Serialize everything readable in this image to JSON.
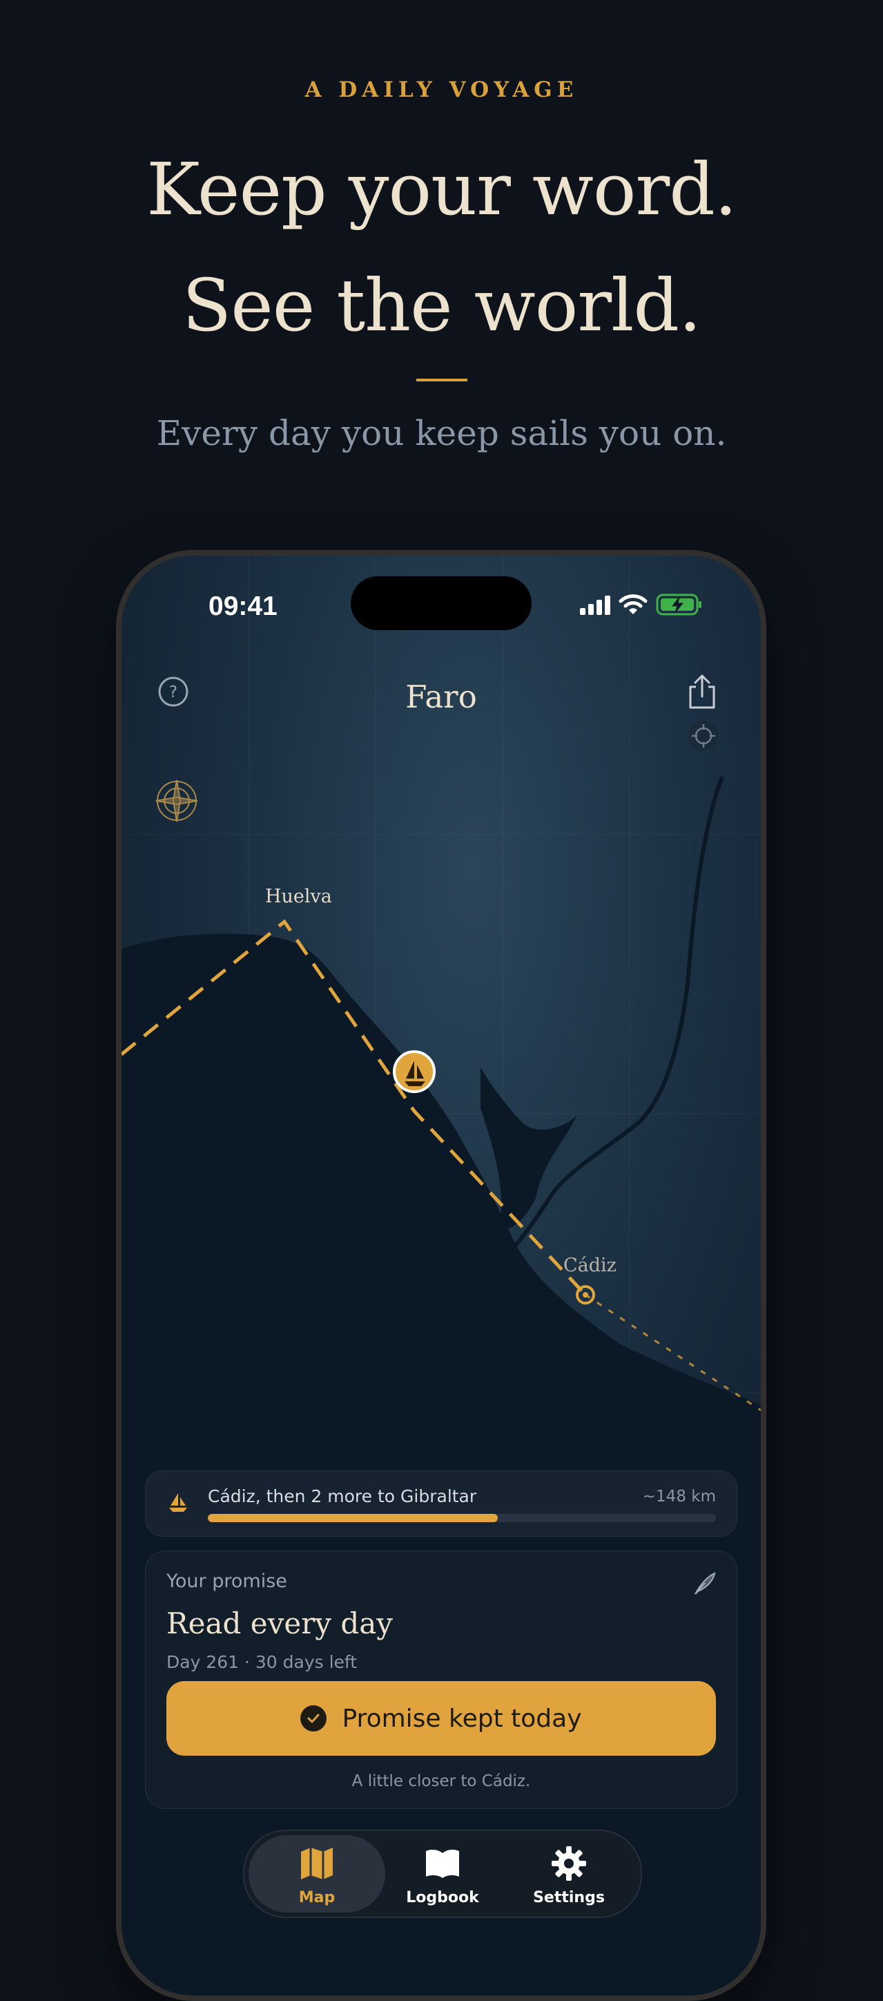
{
  "hero": {
    "kicker": "A DAILY VOYAGE",
    "headline_line1": "Keep your word.",
    "headline_line2": "See the world.",
    "subtitle": "Every day you keep sails you on."
  },
  "status_bar": {
    "time": "09:41",
    "battery": "charging"
  },
  "nav": {
    "title": "Faro"
  },
  "map": {
    "labels": {
      "origin": "Huelva",
      "destination": "Cádiz"
    },
    "colors": {
      "route": "#e0a53c",
      "water": "#1c3447",
      "land": "#0b1826"
    }
  },
  "progress": {
    "text": "Cádiz, then 2 more to Gibraltar",
    "distance": "~148 km",
    "fraction": 0.57
  },
  "promise": {
    "label": "Your promise",
    "title": "Read every day",
    "meta": "Day 261 · 30 days left",
    "button_label": "Promise kept today",
    "footnote": "A little closer to Cádiz."
  },
  "tabs": [
    {
      "label": "Map",
      "icon": "map-icon",
      "active": true
    },
    {
      "label": "Logbook",
      "icon": "book-icon",
      "active": false
    },
    {
      "label": "Settings",
      "icon": "gear-icon",
      "active": false
    }
  ]
}
